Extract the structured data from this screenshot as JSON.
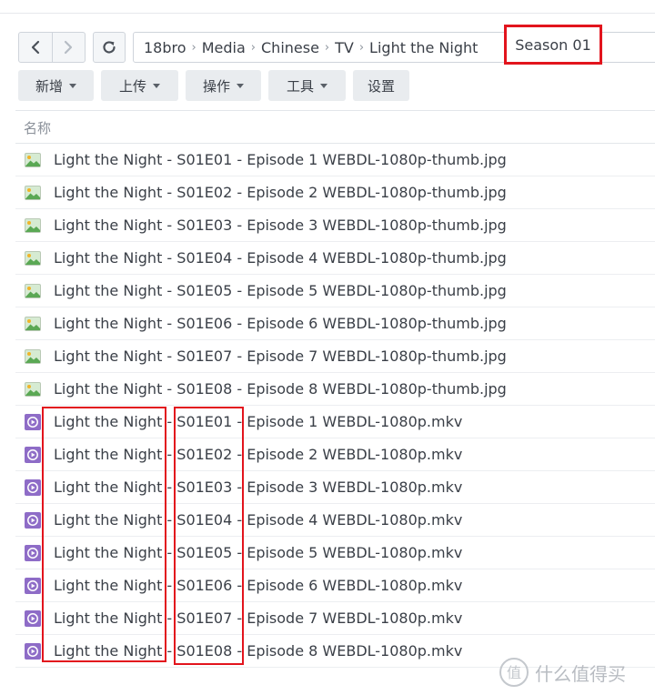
{
  "breadcrumb": {
    "items": [
      "18bro",
      "Media",
      "Chinese",
      "TV",
      "Light the Night"
    ],
    "current": "Season 01"
  },
  "toolbar": {
    "create": "新增",
    "upload": "上传",
    "action": "操作",
    "tools": "工具",
    "settings": "设置"
  },
  "list": {
    "column_name": "名称",
    "files": [
      {
        "name": "Light the Night - S01E01 - Episode 1 WEBDL-1080p-thumb.jpg",
        "type": "image-icon"
      },
      {
        "name": "Light the Night - S01E02 - Episode 2 WEBDL-1080p-thumb.jpg",
        "type": "image-icon"
      },
      {
        "name": "Light the Night - S01E03 - Episode 3 WEBDL-1080p-thumb.jpg",
        "type": "image-icon"
      },
      {
        "name": "Light the Night - S01E04 - Episode 4 WEBDL-1080p-thumb.jpg",
        "type": "image-icon"
      },
      {
        "name": "Light the Night - S01E05 - Episode 5 WEBDL-1080p-thumb.jpg",
        "type": "image-icon"
      },
      {
        "name": "Light the Night - S01E06 - Episode 6 WEBDL-1080p-thumb.jpg",
        "type": "image-icon"
      },
      {
        "name": "Light the Night - S01E07 - Episode 7 WEBDL-1080p-thumb.jpg",
        "type": "image-icon"
      },
      {
        "name": "Light the Night - S01E08 - Episode 8 WEBDL-1080p-thumb.jpg",
        "type": "image-icon"
      },
      {
        "name": "Light the Night - S01E01 - Episode 1 WEBDL-1080p.mkv",
        "type": "video-icon"
      },
      {
        "name": "Light the Night - S01E02 - Episode 2 WEBDL-1080p.mkv",
        "type": "video-icon"
      },
      {
        "name": "Light the Night - S01E03 - Episode 3 WEBDL-1080p.mkv",
        "type": "video-icon"
      },
      {
        "name": "Light the Night - S01E04 - Episode 4 WEBDL-1080p.mkv",
        "type": "video-icon"
      },
      {
        "name": "Light the Night - S01E05 - Episode 5 WEBDL-1080p.mkv",
        "type": "video-icon"
      },
      {
        "name": "Light the Night - S01E06 - Episode 6 WEBDL-1080p.mkv",
        "type": "video-icon"
      },
      {
        "name": "Light the Night - S01E07 - Episode 7 WEBDL-1080p.mkv",
        "type": "video-icon"
      },
      {
        "name": "Light the Night - S01E08 - Episode 8 WEBDL-1080p.mkv",
        "type": "video-icon"
      }
    ]
  },
  "watermark": {
    "symbol": "值",
    "text": "什么值得买"
  },
  "colors": {
    "highlight": "#e2141d",
    "video_icon": "#8e6cc7",
    "image_icon_sky": "#d6ebd2",
    "image_icon_hill": "#5aa854",
    "image_icon_sun": "#f0b429"
  }
}
